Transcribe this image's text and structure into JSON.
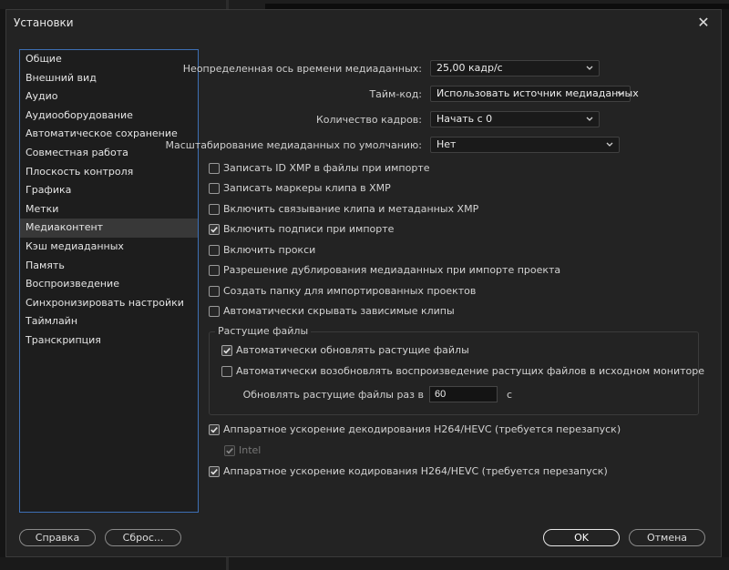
{
  "dialog": {
    "title": "Установки",
    "close_glyph": "✕"
  },
  "sidebar": {
    "items": [
      {
        "label": "Общие"
      },
      {
        "label": "Внешний вид"
      },
      {
        "label": "Аудио"
      },
      {
        "label": "Аудиооборудование"
      },
      {
        "label": "Автоматическое сохранение"
      },
      {
        "label": "Совместная работа"
      },
      {
        "label": "Плоскость контроля"
      },
      {
        "label": "Графика"
      },
      {
        "label": "Метки"
      },
      {
        "label": "Медиаконтент",
        "active": true
      },
      {
        "label": "Кэш медиаданных"
      },
      {
        "label": "Память"
      },
      {
        "label": "Воспроизведение"
      },
      {
        "label": "Синхронизировать настройки"
      },
      {
        "label": "Таймлайн"
      },
      {
        "label": "Транскрипция"
      }
    ]
  },
  "settings": {
    "timebase": {
      "label": "Неопределенная ось времени медиаданных:",
      "value": "25,00 кадр/с"
    },
    "timecode": {
      "label": "Тайм-код:",
      "value": "Использовать источник медиаданных"
    },
    "frame_count": {
      "label": "Количество кадров:",
      "value": "Начать с 0"
    },
    "default_scaling": {
      "label": "Масштабирование медиаданных по умолчанию:",
      "value": "Нет"
    }
  },
  "checkboxes": {
    "write_xmp": {
      "label": "Записать ID XMP в файлы при импорте",
      "checked": false
    },
    "write_clip_markers": {
      "label": "Записать маркеры клипа в XMP",
      "checked": false
    },
    "clip_xmp_link": {
      "label": "Включить связывание клипа и метаданных XMP",
      "checked": false
    },
    "captions_on_import": {
      "label": "Включить подписи при импорте",
      "checked": true
    },
    "enable_proxies": {
      "label": "Включить прокси",
      "checked": false
    },
    "allow_duplicate": {
      "label": "Разрешение дублирования медиаданных при импорте проекта",
      "checked": false
    },
    "create_folder": {
      "label": "Создать папку для импортированных проектов",
      "checked": false
    },
    "auto_hide_dependent": {
      "label": "Автоматически скрывать зависимые клипы",
      "checked": false
    },
    "hw_decode": {
      "label": "Аппаратное ускорение декодирования H264/HEVC (требуется перезапуск)",
      "checked": true
    },
    "intel": {
      "label": "Intel",
      "checked": true,
      "disabled": true
    },
    "hw_encode": {
      "label": "Аппаратное ускорение кодирования H264/HEVC (требуется перезапуск)",
      "checked": true
    }
  },
  "growing_files": {
    "title": "Растущие файлы",
    "auto_refresh": {
      "label": "Автоматически обновлять растущие файлы",
      "checked": true
    },
    "auto_resume": {
      "label": "Автоматически возобновлять воспроизведение растущих файлов в исходном мониторе",
      "checked": false
    },
    "refresh_interval": {
      "label": "Обновлять растущие файлы раз в",
      "value": "60",
      "unit": "с"
    }
  },
  "buttons": {
    "help": "Справка",
    "reset": "Сброс...",
    "ok": "OK",
    "cancel": "Отмена"
  },
  "icons": {
    "dropdown": "chevron-down-icon",
    "check": "checkmark-icon",
    "close": "close-icon"
  }
}
